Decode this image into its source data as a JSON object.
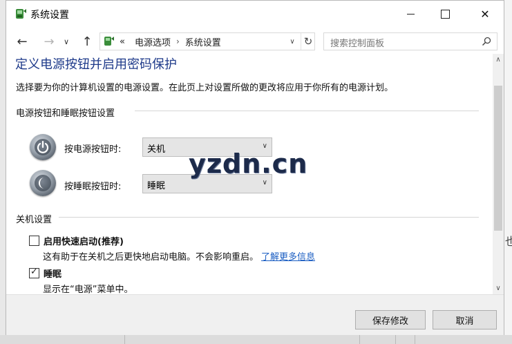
{
  "window": {
    "title": "系统设置"
  },
  "address": {
    "overflow": "«",
    "segments": [
      "电源选项",
      "系统设置"
    ],
    "separator": "›"
  },
  "search": {
    "placeholder": "搜索控制面板"
  },
  "page": {
    "title": "定义电源按钮并启用密码保护",
    "description": "选择要为你的计算机设置的电源设置。在此页上对设置所做的更改将应用于你所有的电源计划。"
  },
  "power_section": {
    "heading": "电源按钮和睡眠按钮设置",
    "rows": [
      {
        "label": "按电源按钮时:",
        "value": "关机"
      },
      {
        "label": "按睡眠按钮时:",
        "value": "睡眠"
      }
    ]
  },
  "shutdown_section": {
    "heading": "关机设置",
    "items": [
      {
        "label": "启用快速启动(推荐)",
        "checked": false,
        "desc": "这有助于在关机之后更快地启动电脑。不会影响重启。",
        "link": "了解更多信息"
      },
      {
        "label": "睡眠",
        "checked": true,
        "desc": "显示在“电源”菜单中。"
      }
    ]
  },
  "footer": {
    "save": "保存修改",
    "cancel": "取消"
  },
  "watermark": "yzdn.cn",
  "background": {
    "edge_glyph": "也"
  },
  "colors": {
    "title": "#1e3a8a",
    "link": "#1a5dc2"
  }
}
